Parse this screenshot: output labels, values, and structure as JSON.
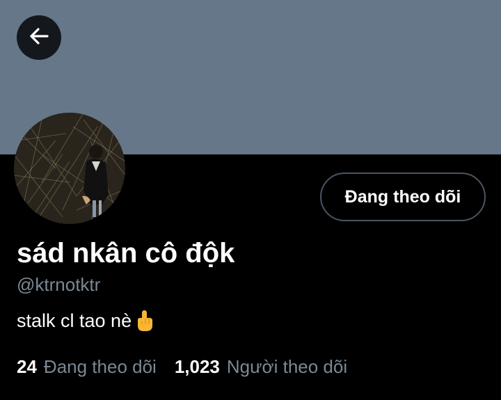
{
  "profile": {
    "display_name": "sád nkân cô độk",
    "handle": "@ktrnotktr",
    "bio": "stalk cl tao nè",
    "bio_emoji": "pointing-up-finger-emoji",
    "follow_button_label": "Đang theo dõi"
  },
  "stats": {
    "following_count": "24",
    "following_label": "Đang theo dõi",
    "followers_count": "1,023",
    "followers_label": "Người theo dõi"
  },
  "icons": {
    "back": "arrow-left-icon"
  },
  "colors": {
    "banner": "#66778a",
    "background": "#000000",
    "secondary_text": "#7b8894",
    "button_border": "#4a5562"
  }
}
